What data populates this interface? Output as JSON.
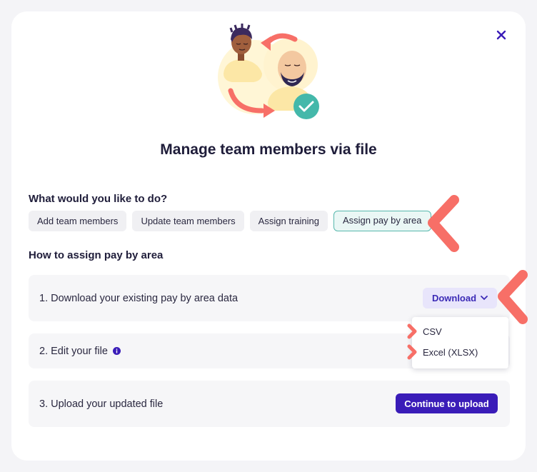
{
  "dialog": {
    "title": "Manage team members via file",
    "close_icon": "close-icon"
  },
  "actions": {
    "heading": "What would you like to do?",
    "options": [
      {
        "label": "Add team members",
        "selected": false
      },
      {
        "label": "Update team members",
        "selected": false
      },
      {
        "label": "Assign training",
        "selected": false
      },
      {
        "label": "Assign pay by area",
        "selected": true
      }
    ]
  },
  "instructions": {
    "heading": "How to assign pay by area",
    "steps": [
      {
        "label": "1. Download your existing pay by area data"
      },
      {
        "label": "2. Edit your file",
        "icon": "info-icon"
      },
      {
        "label": "3. Upload your updated file"
      }
    ]
  },
  "download": {
    "label": "Download",
    "icon": "chevron-down-icon",
    "menu": [
      "CSV",
      "Excel (XLSX)"
    ]
  },
  "upload": {
    "label": "Continue to upload"
  },
  "colors": {
    "accent": "#3a1cb8",
    "selected_border": "#58b8ad",
    "highlight_marker": "#f76f67"
  }
}
